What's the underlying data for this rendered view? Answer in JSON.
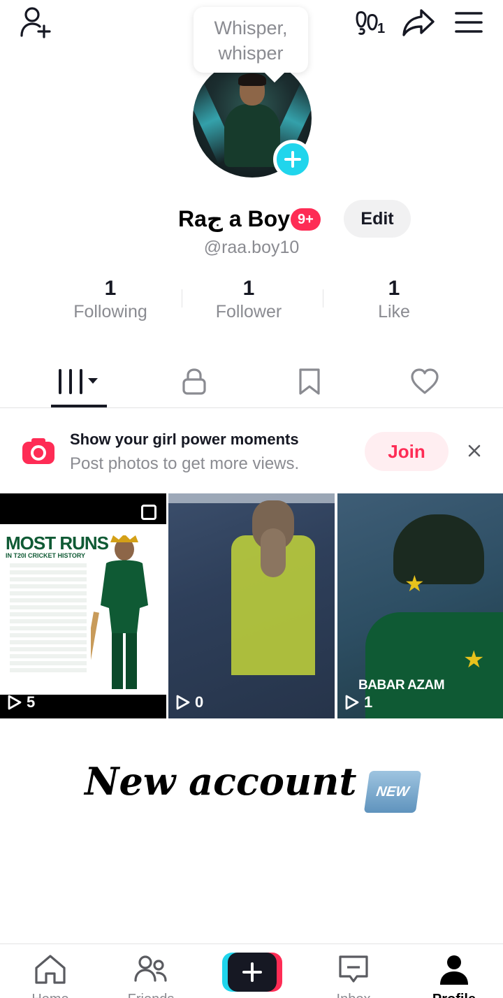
{
  "header": {
    "footprint_count": "1"
  },
  "bubble": {
    "text": "Whisper, whisper"
  },
  "profile": {
    "display_name": "Raج a Boy",
    "notification_badge": "9+",
    "edit_label": "Edit",
    "username": "@raa.boy10"
  },
  "stats": [
    {
      "value": "1",
      "label": "Following"
    },
    {
      "value": "1",
      "label": "Follower"
    },
    {
      "value": "1",
      "label": "Like"
    }
  ],
  "tabs": [
    "videos-grid-icon",
    "lock-icon",
    "bookmark-icon",
    "heart-icon"
  ],
  "promo": {
    "title": "Show your girl power moments",
    "subtitle": "Post photos to get more views.",
    "join_label": "Join"
  },
  "videos": [
    {
      "views": "5",
      "title": "MOST RUNS",
      "subtitle": "IN T20I CRICKET HISTORY"
    },
    {
      "views": "0"
    },
    {
      "views": "1",
      "caption": "BABAR AZAM"
    }
  ],
  "banner": {
    "text": "New account",
    "emoji_label": "NEW"
  },
  "nav": {
    "items": [
      {
        "label": "Home",
        "icon": "home-icon"
      },
      {
        "label": "Friends",
        "icon": "friends-icon"
      },
      {
        "label": "",
        "icon": "plus-icon"
      },
      {
        "label": "Inbox",
        "icon": "inbox-icon"
      },
      {
        "label": "Profile",
        "icon": "profile-icon"
      }
    ]
  },
  "colors": {
    "accent_red": "#fe2c55",
    "accent_cyan": "#20d5ec",
    "text_primary": "#161823",
    "text_secondary": "#8a8b91"
  }
}
